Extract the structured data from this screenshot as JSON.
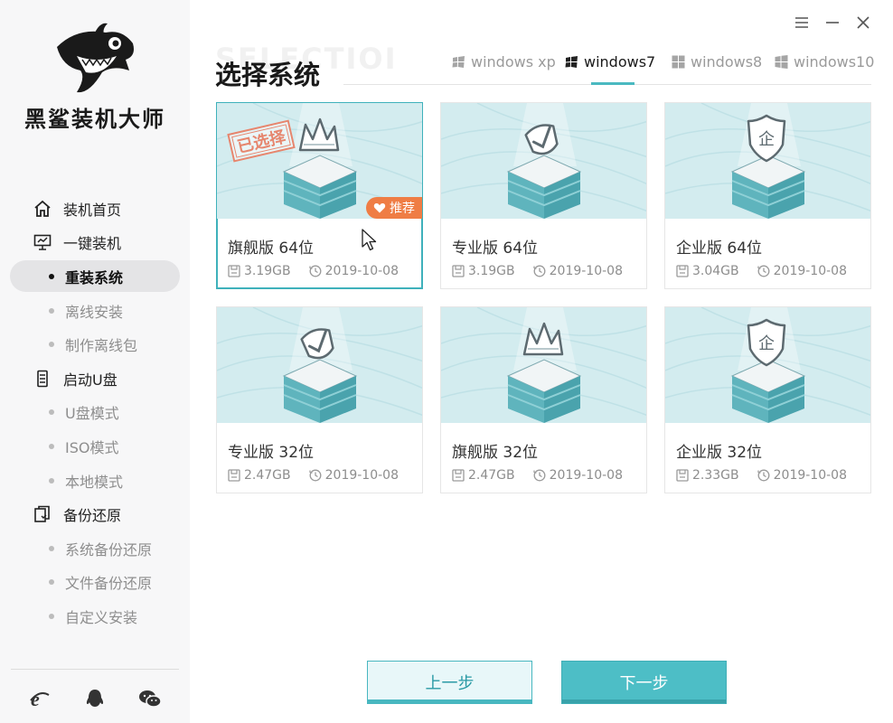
{
  "app": {
    "brand": "黑鲨装机大师"
  },
  "window_controls": {
    "menu_icon": "menu-icon",
    "minimize_icon": "minimize-icon",
    "close_icon": "close-icon"
  },
  "sidebar": {
    "items": [
      {
        "type": "item",
        "icon": "home-icon",
        "label": "装机首页"
      },
      {
        "type": "item",
        "icon": "monitor-icon",
        "label": "一键装机"
      },
      {
        "type": "sub",
        "label": "重装系统",
        "active": true
      },
      {
        "type": "sub",
        "label": "离线安装"
      },
      {
        "type": "sub",
        "label": "制作离线包"
      },
      {
        "type": "item",
        "icon": "usb-drive-icon",
        "label": "启动U盘"
      },
      {
        "type": "sub",
        "label": "U盘模式"
      },
      {
        "type": "sub",
        "label": "ISO模式"
      },
      {
        "type": "sub",
        "label": "本地模式"
      },
      {
        "type": "item",
        "icon": "backup-icon",
        "label": "备份还原"
      },
      {
        "type": "sub",
        "label": "系统备份还原"
      },
      {
        "type": "sub",
        "label": "文件备份还原"
      },
      {
        "type": "sub",
        "label": "自定义安装"
      }
    ],
    "social": [
      "ie-icon",
      "qq-icon",
      "wechat-icon"
    ]
  },
  "main": {
    "bg_title": "SELECTIOI",
    "title": "选择系统",
    "tabs": [
      {
        "label": "windows xp",
        "icon": "windows-xp-icon",
        "active": false
      },
      {
        "label": "windows7",
        "icon": "windows7-icon",
        "active": true
      },
      {
        "label": "windows8",
        "icon": "windows8-icon",
        "active": false
      },
      {
        "label": "windows10",
        "icon": "windows10-icon",
        "active": false
      }
    ],
    "cards": [
      {
        "name": "旗舰版 64位",
        "size": "3.19GB",
        "date": "2019-10-08",
        "emblem": "crown",
        "selected": true,
        "stamp": "已选择",
        "badge": "推荐"
      },
      {
        "name": "专业版 64位",
        "size": "3.19GB",
        "date": "2019-10-08",
        "emblem": "check"
      },
      {
        "name": "企业版 64位",
        "size": "3.04GB",
        "date": "2019-10-08",
        "emblem": "shield"
      },
      {
        "name": "专业版 32位",
        "size": "2.47GB",
        "date": "2019-10-08",
        "emblem": "check"
      },
      {
        "name": "旗舰版 32位",
        "size": "2.47GB",
        "date": "2019-10-08",
        "emblem": "crown"
      },
      {
        "name": "企业版 32位",
        "size": "2.33GB",
        "date": "2019-10-08",
        "emblem": "shield"
      }
    ]
  },
  "footer": {
    "prev_label": "上一步",
    "next_label": "下一步"
  },
  "colors": {
    "accent": "#4dbec6",
    "stamp": "#e6866e",
    "badge": "#ef7d45",
    "card_image_bg": "#cfeaee"
  }
}
